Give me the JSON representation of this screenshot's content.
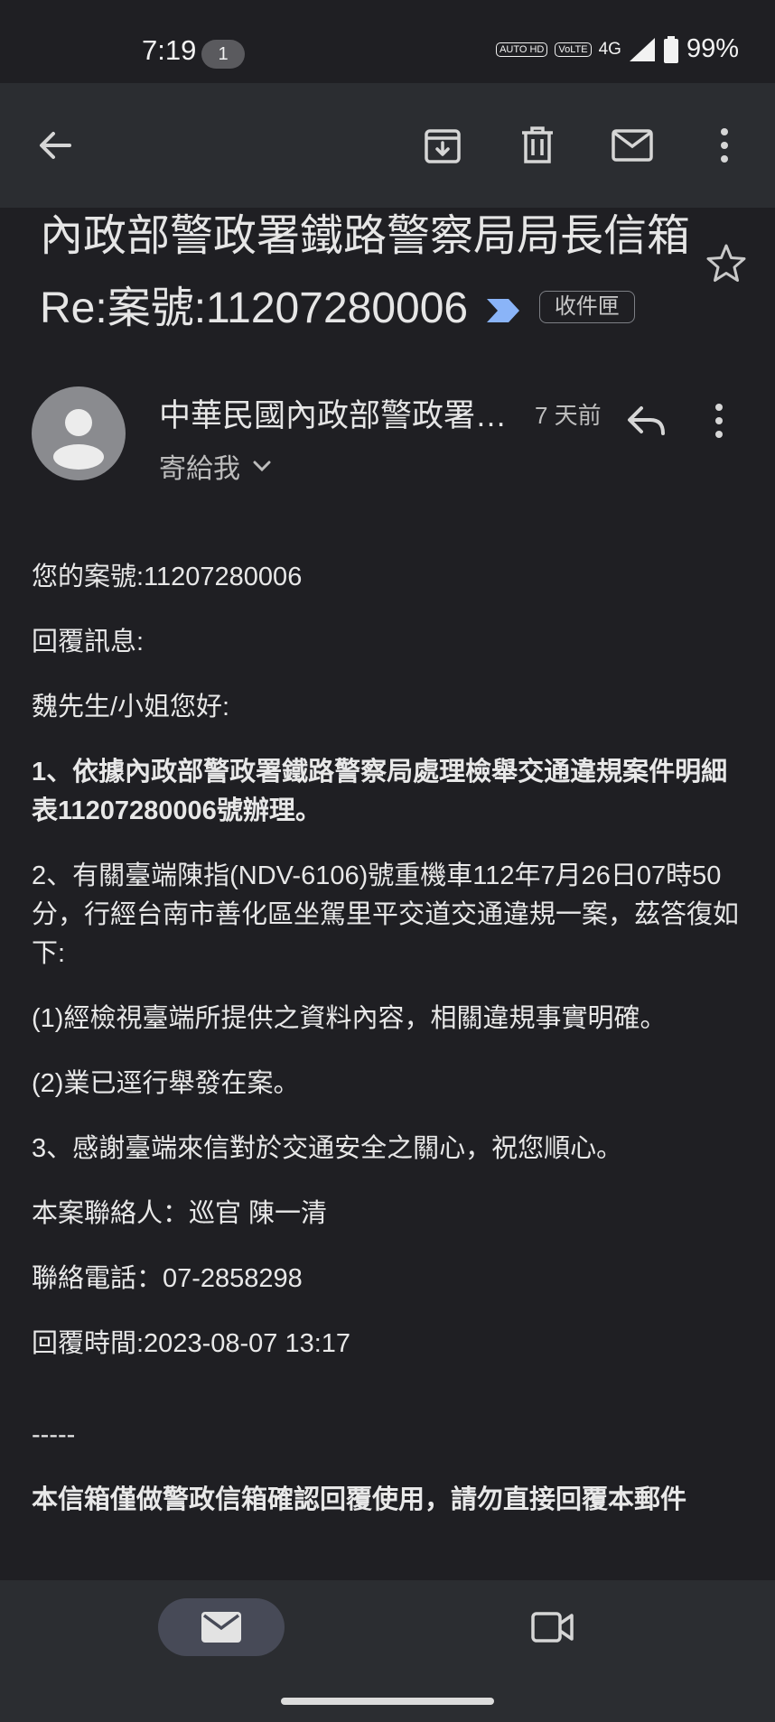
{
  "status_bar": {
    "time": "7:19",
    "notification_count": "1",
    "auto_hd_label": "AUTO HD",
    "volte_label": "VoLTE",
    "network_label": "4G",
    "battery_percent": "99%"
  },
  "toolbar": {
    "icons": [
      "back-arrow-icon",
      "archive-icon",
      "delete-icon",
      "mark-unread-icon",
      "more-vert-icon"
    ]
  },
  "email": {
    "subject": "內政部警政署鐵路警察局局長信箱 Re:案號:11207280006",
    "label": "收件匣",
    "sender": "中華民國內政部警政署…",
    "time_ago": "7 天前",
    "to": "寄給我"
  },
  "body": {
    "line1": "您的案號:11207280006",
    "line2": "回覆訊息:",
    "line3": "魏先生/小姐您好:",
    "line4": "1、依據內政部警政署鐵路警察局處理檢舉交通違規案件明細表11207280006號辦理。",
    "line5": "2、有關臺端陳指(NDV-6106)號重機車112年7月26日07時50分，行經台南市善化區坐駕里平交道交通違規一案，茲答復如下:",
    "line6": "(1)經檢視臺端所提供之資料內容，相關違規事實明確。",
    "line7": "(2)業已逕行舉發在案。",
    "line8": "3、感謝臺端來信對於交通安全之關心，祝您順心。",
    "line9": "本案聯絡人：巡官 陳一清",
    "line10": "聯絡電話：07-2858298",
    "line11": "回覆時間:2023-08-07 13:17",
    "line12": "-----",
    "line13": "本信箱僅做警政信箱確認回覆使用，請勿直接回覆本郵件"
  },
  "bottom_nav": {
    "items": [
      "mail-icon",
      "video-icon"
    ],
    "active": "mail-icon"
  },
  "colors": {
    "background": "#1f1f23",
    "bar": "#2b2d31",
    "active_pill": "#474a57",
    "importance_marker": "#8ab4f8"
  }
}
